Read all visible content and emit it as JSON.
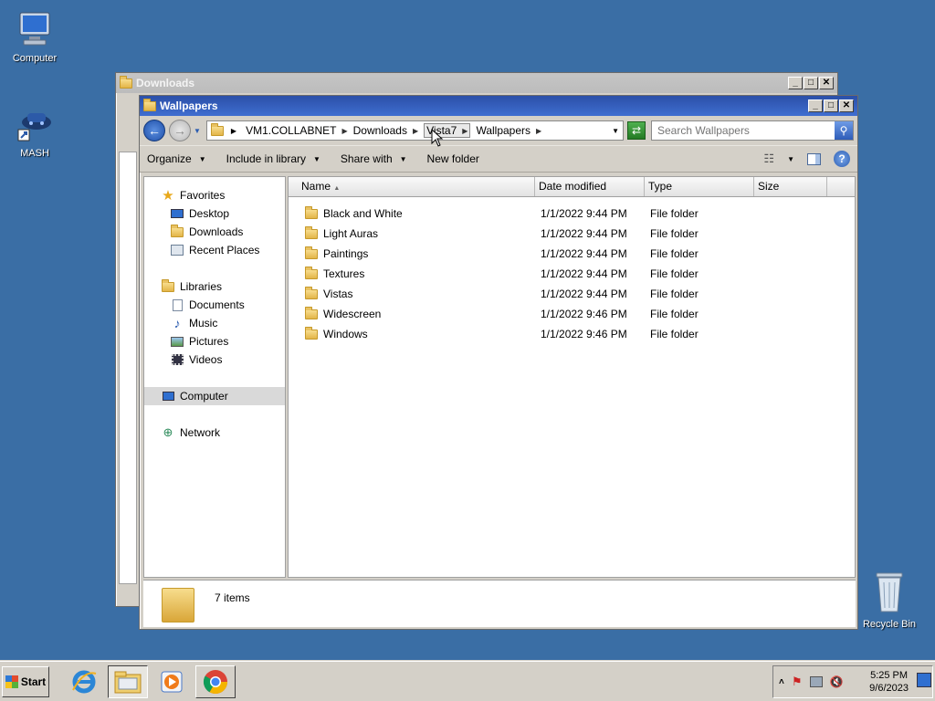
{
  "desktop": {
    "icons": [
      {
        "label": "Computer"
      },
      {
        "label": "MASH"
      },
      {
        "label": "Recycle Bin"
      }
    ]
  },
  "back_window": {
    "title": "Downloads"
  },
  "window": {
    "title": "Wallpapers",
    "address": {
      "crumbs": [
        "VM1.COLLABNET",
        "Downloads",
        "Vista7",
        "Wallpapers"
      ]
    },
    "search": {
      "placeholder": "Search Wallpapers"
    },
    "commands": {
      "organize": "Organize",
      "include": "Include in library",
      "share": "Share with",
      "new_folder": "New folder"
    },
    "nav": {
      "favorites": "Favorites",
      "desktop": "Desktop",
      "downloads": "Downloads",
      "recent": "Recent Places",
      "libraries": "Libraries",
      "documents": "Documents",
      "music": "Music",
      "pictures": "Pictures",
      "videos": "Videos",
      "computer": "Computer",
      "network": "Network"
    },
    "columns": {
      "name": "Name",
      "date": "Date modified",
      "type": "Type",
      "size": "Size"
    },
    "files": [
      {
        "name": "Black and White",
        "date": "1/1/2022 9:44 PM",
        "type": "File folder"
      },
      {
        "name": "Light Auras",
        "date": "1/1/2022 9:44 PM",
        "type": "File folder"
      },
      {
        "name": "Paintings",
        "date": "1/1/2022 9:44 PM",
        "type": "File folder"
      },
      {
        "name": "Textures",
        "date": "1/1/2022 9:44 PM",
        "type": "File folder"
      },
      {
        "name": "Vistas",
        "date": "1/1/2022 9:44 PM",
        "type": "File folder"
      },
      {
        "name": "Widescreen",
        "date": "1/1/2022 9:46 PM",
        "type": "File folder"
      },
      {
        "name": "Windows",
        "date": "1/1/2022 9:46 PM",
        "type": "File folder"
      }
    ],
    "status": "7 items"
  },
  "taskbar": {
    "start": "Start",
    "time": "5:25 PM",
    "date": "9/6/2023"
  },
  "colors": {
    "desktop": "#3a6ea5",
    "active_title": "#2b4fa8",
    "folder": "#e3b548"
  }
}
